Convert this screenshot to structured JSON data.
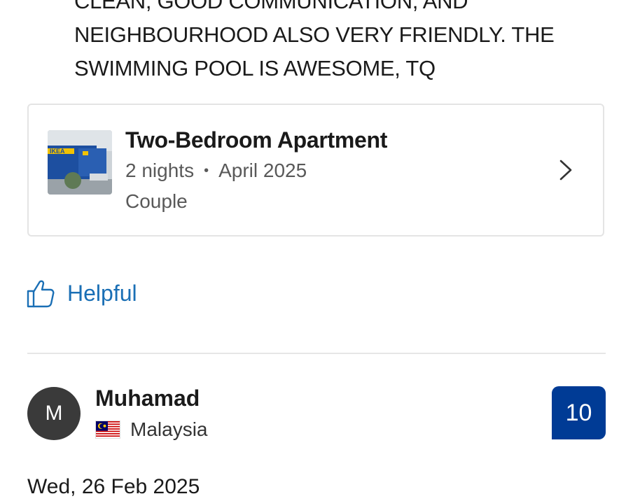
{
  "review": {
    "text_line_top": "CLEAN, GOOD COMMUNICATION, AND",
    "text_line_1": "NEIGHBOURHOOD ALSO VERY FRIENDLY. THE",
    "text_line_2": "SWIMMING POOL IS AWESOME, TQ"
  },
  "stay": {
    "thumbnail_icon": "property-photo",
    "thumbnail_text": "IKEA",
    "room_name": "Two-Bedroom Apartment",
    "nights": "2 nights",
    "separator": "•",
    "month": "April 2025",
    "traveler_type": "Couple"
  },
  "helpful": {
    "icon": "thumbs-up-icon",
    "label": "Helpful"
  },
  "next_review": {
    "avatar_initial": "M",
    "name": "Muhamad",
    "country": "Malaysia",
    "score": "10",
    "date": "Wed, 26 Feb 2025"
  },
  "colors": {
    "link_blue": "#1a6fb5",
    "score_blue": "#003b95",
    "avatar_bg": "#3a3a3a"
  }
}
